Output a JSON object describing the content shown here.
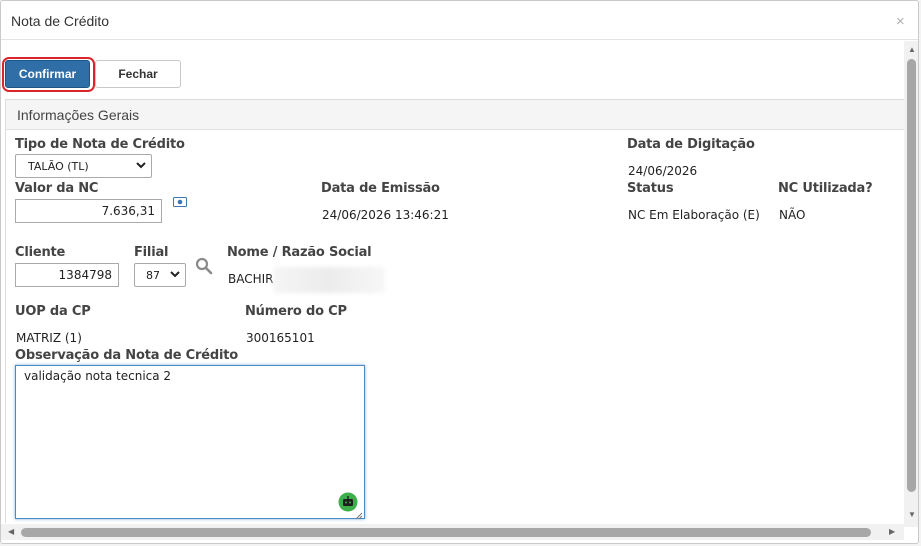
{
  "dialog": {
    "title": "Nota de Crédito",
    "close_symbol": "×"
  },
  "actions": {
    "confirm_label": "Confirmar",
    "close_label": "Fechar"
  },
  "section": {
    "title": "Informações Gerais"
  },
  "form": {
    "tipo_label": "Tipo de Nota de Crédito",
    "tipo_value": "TALÃO (TL)",
    "data_digitacao_label": "Data de Digitação",
    "data_digitacao_value": "24/06/2026",
    "valor_label": "Valor da NC",
    "valor_value": "7.636,31",
    "data_emissao_label": "Data de Emissão",
    "data_emissao_value": "24/06/2026 13:46:21",
    "status_label": "Status",
    "status_value": "NC Em Elaboração (E)",
    "nc_utilizada_label": "NC Utilizada?",
    "nc_utilizada_value": "NÃO",
    "cliente_label": "Cliente",
    "cliente_value": "1384798",
    "filial_label": "Filial",
    "filial_value": "87",
    "nome_label": "Nome / Razão Social",
    "nome_value": "BACHIR",
    "uop_label": "UOP da CP",
    "uop_value": "MATRIZ (1)",
    "numero_cp_label": "Número do CP",
    "numero_cp_value": "300165101",
    "observacao_label": "Observação da Nota de Crédito",
    "observacao_value": "validação nota tecnica 2"
  },
  "icons": {
    "money": "money-icon",
    "search": "search-icon",
    "assistant": "robot-icon",
    "chevron": "chevron-down-icon"
  },
  "colors": {
    "primary_button": "#2f6ea6",
    "highlight_ring": "#d9262b",
    "assistant_badge": "#3cae4a"
  }
}
